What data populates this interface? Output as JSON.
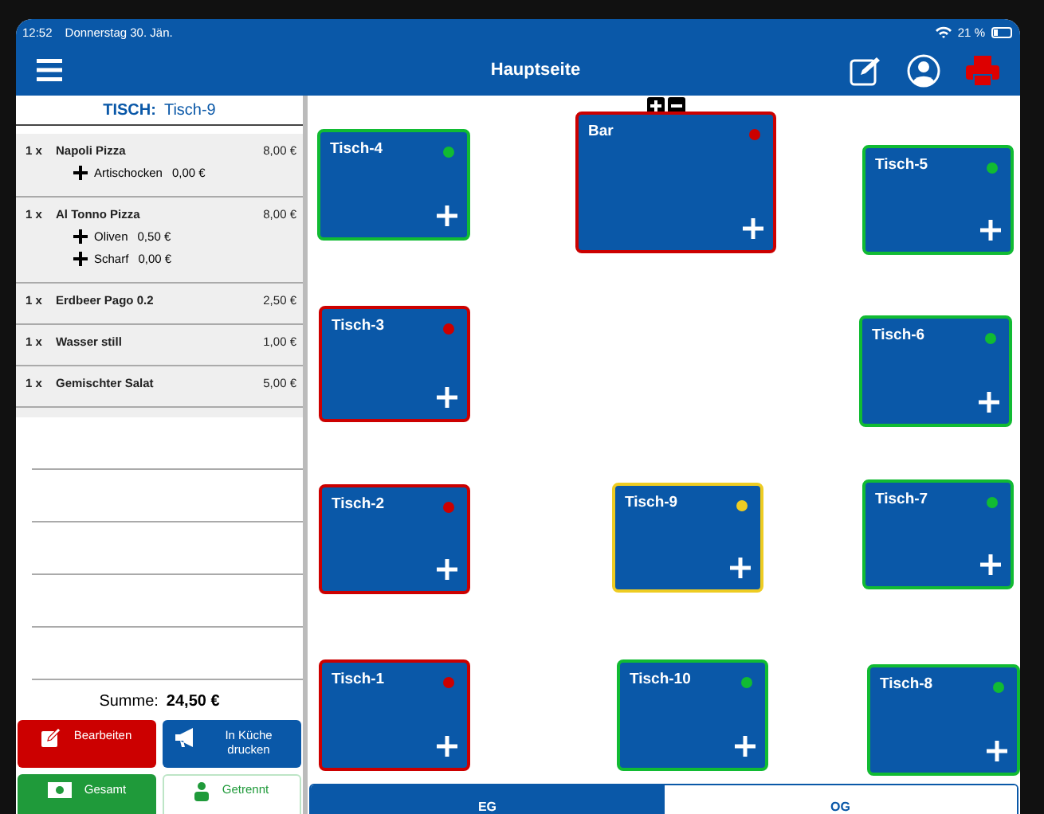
{
  "status_bar": {
    "time": "12:52",
    "date": "Donnerstag 30. Jän.",
    "battery": "21 %"
  },
  "header": {
    "title": "Hauptseite"
  },
  "order": {
    "table_label": "TISCH:",
    "table_name": "Tisch-9",
    "items": [
      {
        "qty": "1 x",
        "name": "Napoli Pizza",
        "price": "8,00 €",
        "extras": [
          {
            "name": "Artischocken",
            "price": "0,00 €"
          }
        ]
      },
      {
        "qty": "1 x",
        "name": "Al Tonno Pizza",
        "price": "8,00 €",
        "extras": [
          {
            "name": "Oliven",
            "price": "0,50 €"
          },
          {
            "name": "Scharf",
            "price": "0,00 €"
          }
        ]
      },
      {
        "qty": "1 x",
        "name": "Erdbeer Pago 0.2",
        "price": "2,50 €"
      },
      {
        "qty": "1 x",
        "name": "Wasser still",
        "price": "1,00 €"
      },
      {
        "qty": "1 x",
        "name": "Gemischter Salat",
        "price": "5,00 €"
      }
    ],
    "sum_label": "Summe:",
    "sum": "24,50 €"
  },
  "actions": [
    {
      "kind": "edit",
      "label": "Bearbeiten"
    },
    {
      "kind": "kitchen",
      "label": "In Küche drucken"
    },
    {
      "kind": "pay_all",
      "label": "Gesamt"
    },
    {
      "kind": "pay_split",
      "label": "Getrennt"
    }
  ],
  "tables": [
    {
      "name": "Tisch-4",
      "color": "#11bb33"
    },
    {
      "name": "Bar",
      "color": "#cc0000"
    },
    {
      "name": "Tisch-5",
      "color": "#11bb33"
    },
    {
      "name": "Tisch-3",
      "color": "#cc0000"
    },
    {
      "name": "Tisch-6",
      "color": "#11bb33"
    },
    {
      "name": "Tisch-2",
      "color": "#cc0000"
    },
    {
      "name": "Tisch-9",
      "color": "#eecc22"
    },
    {
      "name": "Tisch-7",
      "color": "#11bb33"
    },
    {
      "name": "Tisch-1",
      "color": "#cc0000"
    },
    {
      "name": "Tisch-10",
      "color": "#11bb33"
    },
    {
      "name": "Tisch-8",
      "color": "#11bb33"
    }
  ],
  "floors": [
    {
      "label": "EG",
      "selected": true
    },
    {
      "label": "OG",
      "selected": false
    }
  ]
}
